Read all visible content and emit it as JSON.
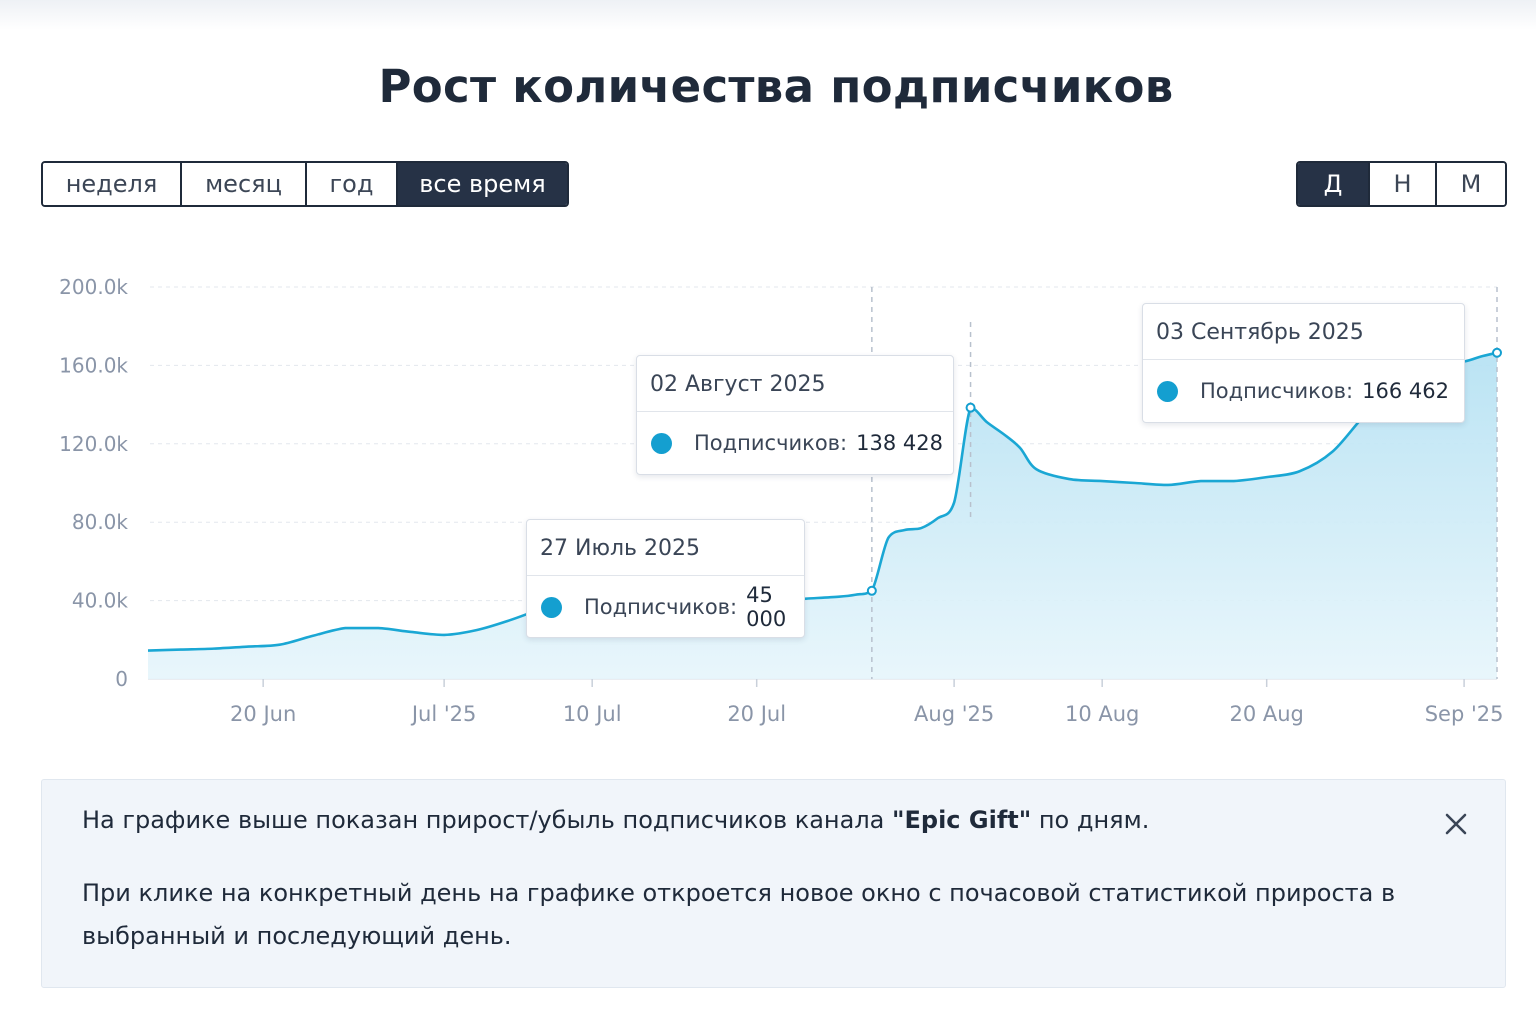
{
  "header": {
    "title": "Рост количества подписчиков"
  },
  "range_buttons": [
    {
      "label": "неделя",
      "active": false
    },
    {
      "label": "месяц",
      "active": false
    },
    {
      "label": "год",
      "active": false
    },
    {
      "label": "все время",
      "active": true
    }
  ],
  "scale_buttons": [
    {
      "label": "Д",
      "active": true
    },
    {
      "label": "Н",
      "active": false
    },
    {
      "label": "М",
      "active": false
    }
  ],
  "chart_data": {
    "type": "area",
    "title": "",
    "xlabel": "",
    "ylabel": "",
    "ylim": [
      0,
      200000
    ],
    "y_ticks": [
      {
        "value": 0,
        "label": "0"
      },
      {
        "value": 40000,
        "label": "40.0k"
      },
      {
        "value": 80000,
        "label": "80.0k"
      },
      {
        "value": 120000,
        "label": "120.0k"
      },
      {
        "value": 160000,
        "label": "160.0k"
      },
      {
        "value": 200000,
        "label": "200.0k"
      }
    ],
    "x_ticks": [
      {
        "date": "2025-06-20",
        "label": "20 Jun"
      },
      {
        "date": "2025-07-01",
        "label": "Jul '25"
      },
      {
        "date": "2025-07-10",
        "label": "10 Jul"
      },
      {
        "date": "2025-07-20",
        "label": "20 Jul"
      },
      {
        "date": "2025-08-01",
        "label": "Aug '25"
      },
      {
        "date": "2025-08-10",
        "label": "10 Aug"
      },
      {
        "date": "2025-08-20",
        "label": "20 Aug"
      },
      {
        "date": "2025-09-01",
        "label": "Sep '25"
      }
    ],
    "grid": true,
    "colors": {
      "line": "#1aa7d4",
      "fill": "#bfe6f4",
      "point": "#149fd0"
    },
    "series": [
      {
        "values": [
          [
            "2025-06-13",
            14500
          ],
          [
            "2025-06-15",
            15000
          ],
          [
            "2025-06-17",
            15500
          ],
          [
            "2025-06-19",
            16500
          ],
          [
            "2025-06-21",
            17500
          ],
          [
            "2025-06-23",
            22000
          ],
          [
            "2025-06-25",
            26000
          ],
          [
            "2025-06-27",
            26000
          ],
          [
            "2025-06-29",
            24000
          ],
          [
            "2025-07-01",
            22500
          ],
          [
            "2025-07-03",
            25000
          ],
          [
            "2025-07-05",
            30000
          ],
          [
            "2025-07-07",
            36000
          ],
          [
            "2025-07-09",
            41000
          ],
          [
            "2025-07-11",
            43000
          ],
          [
            "2025-07-13",
            42000
          ],
          [
            "2025-07-15",
            41500
          ],
          [
            "2025-07-17",
            41000
          ],
          [
            "2025-07-19",
            40500
          ],
          [
            "2025-07-21",
            40000
          ],
          [
            "2025-07-23",
            41000
          ],
          [
            "2025-07-25",
            42000
          ],
          [
            "2025-07-26",
            43000
          ],
          [
            "2025-07-27",
            45000
          ],
          [
            "2025-07-28",
            72000
          ],
          [
            "2025-07-29",
            76000
          ],
          [
            "2025-07-30",
            77000
          ],
          [
            "2025-07-31",
            82000
          ],
          [
            "2025-08-01",
            90000
          ],
          [
            "2025-08-02",
            138428
          ],
          [
            "2025-08-03",
            131000
          ],
          [
            "2025-08-04",
            125000
          ],
          [
            "2025-08-05",
            118000
          ],
          [
            "2025-08-06",
            107000
          ],
          [
            "2025-08-08",
            102000
          ],
          [
            "2025-08-10",
            101000
          ],
          [
            "2025-08-12",
            100000
          ],
          [
            "2025-08-14",
            99000
          ],
          [
            "2025-08-16",
            101000
          ],
          [
            "2025-08-18",
            101000
          ],
          [
            "2025-08-20",
            103000
          ],
          [
            "2025-08-22",
            106000
          ],
          [
            "2025-08-24",
            116000
          ],
          [
            "2025-08-26",
            135000
          ],
          [
            "2025-08-28",
            150000
          ],
          [
            "2025-08-30",
            160000
          ],
          [
            "2025-09-01",
            162000
          ],
          [
            "2025-09-02",
            164500
          ],
          [
            "2025-09-03",
            166462
          ]
        ]
      }
    ],
    "hover_marker": "2025-07-27",
    "tooltips": [
      {
        "date_label": "27 Июль 2025",
        "date": "2025-07-27",
        "series_label": "Подписчиков:",
        "value_label": "45 000"
      },
      {
        "date_label": "02 Август 2025",
        "date": "2025-08-02",
        "series_label": "Подписчиков:",
        "value_label": "138 428"
      },
      {
        "date_label": "03 Сентябрь 2025",
        "date": "2025-09-03",
        "series_label": "Подписчиков:",
        "value_label": "166 462"
      }
    ]
  },
  "info": {
    "line1_before": "На графике выше показан прирост/убыль подписчиков канала ",
    "channel_name": "\"Epic Gift\"",
    "line1_after": " по дням.",
    "line2": "При клике на конкретный день на графике откроется новое окно с почасовой статистикой прироста в выбранный и последующий день."
  },
  "icons": {
    "close": "close-icon"
  }
}
